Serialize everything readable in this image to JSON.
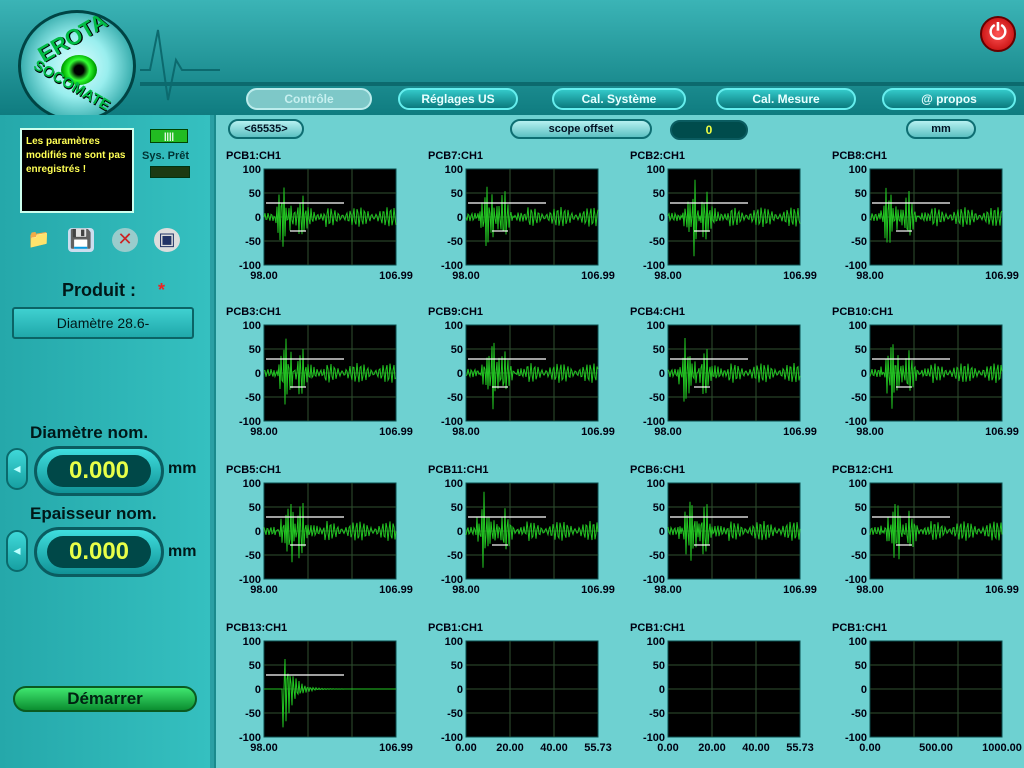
{
  "header": {
    "logo_text_top": "EROTA",
    "logo_text_bottom": "SOCOMATE",
    "tabs": [
      {
        "label": "Contrôle",
        "active": true
      },
      {
        "label": "Réglages US",
        "active": false
      },
      {
        "label": "Cal. Système",
        "active": false
      },
      {
        "label": "Cal. Mesure",
        "active": false
      },
      {
        "label": "@ propos",
        "active": false
      }
    ]
  },
  "sidebar": {
    "message": "Les paramètres modifiés ne sont pas enregistrés !",
    "system_status": "Sys. Prêt",
    "produit_label": "Produit :",
    "produit_marker": "*",
    "produit_value": "Diamètre 28.6-",
    "diametre_label": "Diamètre nom.",
    "diametre_value": "0.000",
    "diametre_unit": "mm",
    "epaisseur_label": "Epaisseur nom.",
    "epaisseur_value": "0.000",
    "epaisseur_unit": "mm",
    "start_label": "Démarrer",
    "icons": [
      "folder-icon",
      "save-icon",
      "delete-icon",
      "image-icon"
    ]
  },
  "toolbar": {
    "range_select": "<65535>",
    "offset_select": "scope offset",
    "offset_value": "0",
    "unit_select": "mm"
  },
  "plots": [
    {
      "title": "PCB1:CH1",
      "xmin": "98.00",
      "xmax": "106.99",
      "signal": true
    },
    {
      "title": "PCB7:CH1",
      "xmin": "98.00",
      "xmax": "106.99",
      "signal": true
    },
    {
      "title": "PCB2:CH1",
      "xmin": "98.00",
      "xmax": "106.99",
      "signal": true
    },
    {
      "title": "PCB8:CH1",
      "xmin": "98.00",
      "xmax": "106.99",
      "signal": true
    },
    {
      "title": "PCB3:CH1",
      "xmin": "98.00",
      "xmax": "106.99",
      "signal": true
    },
    {
      "title": "PCB9:CH1",
      "xmin": "98.00",
      "xmax": "106.99",
      "signal": true
    },
    {
      "title": "PCB4:CH1",
      "xmin": "98.00",
      "xmax": "106.99",
      "signal": true
    },
    {
      "title": "PCB10:CH1",
      "xmin": "98.00",
      "xmax": "106.99",
      "signal": true
    },
    {
      "title": "PCB5:CH1",
      "xmin": "98.00",
      "xmax": "106.99",
      "signal": true
    },
    {
      "title": "PCB11:CH1",
      "xmin": "98.00",
      "xmax": "106.99",
      "signal": true
    },
    {
      "title": "PCB6:CH1",
      "xmin": "98.00",
      "xmax": "106.99",
      "signal": true
    },
    {
      "title": "PCB12:CH1",
      "xmin": "98.00",
      "xmax": "106.99",
      "signal": true
    },
    {
      "title": "PCB13:CH1",
      "xmin": "98.00",
      "xmax": "106.99",
      "signal": "decay"
    },
    {
      "title": "PCB1:CH1",
      "xticks": [
        "0.00",
        "20.00",
        "40.00",
        "55.73"
      ],
      "signal": false
    },
    {
      "title": "PCB1:CH1",
      "xticks": [
        "0.00",
        "20.00",
        "40.00",
        "55.73"
      ],
      "signal": false
    },
    {
      "title": "PCB1:CH1",
      "xticks": [
        "0.00",
        "500.00",
        "1000.00"
      ],
      "signal": false
    }
  ],
  "yticks": [
    "100",
    "50",
    "0",
    "-50",
    "-100"
  ],
  "colors": {
    "signal": "#22c422",
    "gate": "#ffffff",
    "plot_bg": "#000000",
    "grid": "#2f4f2f"
  }
}
